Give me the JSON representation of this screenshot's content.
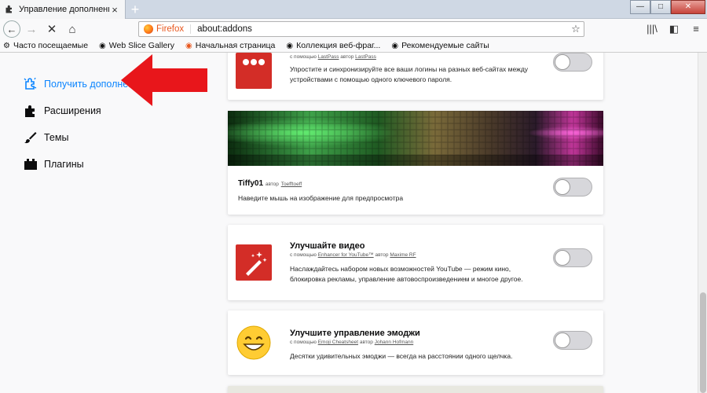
{
  "tab": {
    "title": "Управление дополнениями",
    "close": "×",
    "new": "+"
  },
  "window": {
    "minimize": "—",
    "maximize": "□",
    "close": "✕"
  },
  "nav": {
    "back": "←",
    "forward": "→",
    "stop": "✕",
    "home": "⌂",
    "identity": "Firefox",
    "url": "about:addons",
    "star": "☆",
    "library": "|||\\",
    "sidebar": "◧",
    "menu": "≡"
  },
  "bookmarks": [
    {
      "icon": "⚙",
      "label": "Часто посещаемые"
    },
    {
      "icon": "◉",
      "label": "Web Slice Gallery"
    },
    {
      "icon": "◉",
      "label": "Начальная страница"
    },
    {
      "icon": "◉",
      "label": "Коллекция веб-фраг..."
    },
    {
      "icon": "◉",
      "label": "Рекомендуемые сайты"
    }
  ],
  "sidebar": {
    "items": [
      {
        "label": "Получить дополне..."
      },
      {
        "label": "Расширения"
      },
      {
        "label": "Темы"
      },
      {
        "label": "Плагины"
      }
    ]
  },
  "cards": {
    "lastpass": {
      "sub_prefix": "с помощью",
      "sub_link": "LastPass",
      "sub_author_prefix": "автор",
      "sub_author": "LastPass",
      "desc": "Упростите и синхронизируйте все ваши логины на разных веб-сайтах между устройствами с помощью одного ключевого пароля."
    },
    "tiffy": {
      "title": "Tiffy01",
      "author_prefix": "автор",
      "author": "Toefftoeff",
      "desc": "Наведите мышь на изображение для предпросмотра"
    },
    "video": {
      "title": "Улучшайте видео",
      "sub_prefix": "с помощью",
      "sub_link": "Enhancer for YouTube™",
      "sub_author_prefix": "автор",
      "sub_author": "Maxime RF",
      "desc": "Наслаждайтесь набором новых возможностей YouTube — режим кино, блокировка рекламы, управление автовоспроизведением и многое другое."
    },
    "emoji": {
      "title": "Улучшите управление эмоджи",
      "sub_prefix": "с помощью",
      "sub_link": "Emoji Cheatsheet",
      "sub_author_prefix": "автор",
      "sub_author": "Johann Hofmann",
      "desc": "Десятки удивительных эмоджи — всегда на расстоянии одного щелчка."
    }
  },
  "colors": {
    "accent": "#0a84ff",
    "arrow": "#e8161b",
    "lastpass": "#d32d27",
    "toggle_off": "#d7d7db"
  }
}
